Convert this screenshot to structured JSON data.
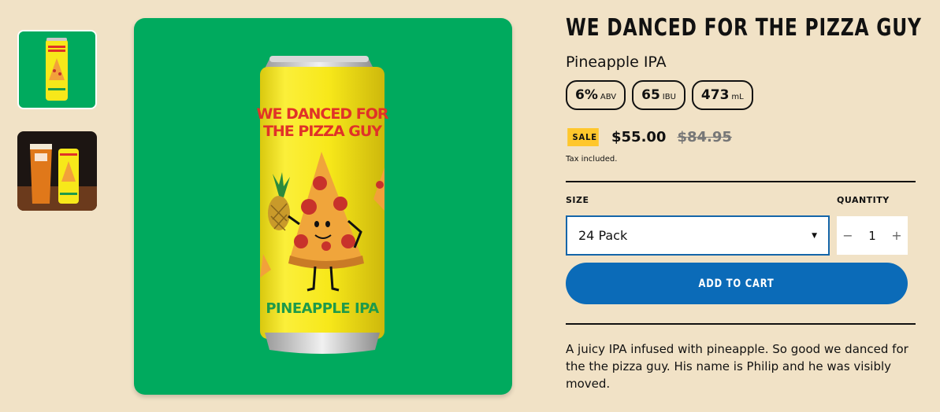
{
  "product": {
    "title": "WE DANCED FOR THE PIZZA GUY",
    "subtitle": "Pineapple IPA",
    "specs": [
      {
        "value": "6%",
        "unit": "ABV"
      },
      {
        "value": "65",
        "unit": "IBU"
      },
      {
        "value": "473",
        "unit": "mL"
      }
    ],
    "sale_label": "SALE",
    "price": "$55.00",
    "compare_price": "$84.95",
    "tax_note": "Tax included.",
    "size_label": "SIZE",
    "size_value": "24 Pack",
    "quantity_label": "QUANTITY",
    "quantity": "1",
    "qty_minus": "−",
    "qty_plus": "+",
    "add_to_cart": "ADD TO CART",
    "description": "A juicy IPA infused with pineapple. So good we danced for the the pizza guy. His name is Philip and he was visibly moved."
  },
  "can_art": {
    "line1": "WE DANCED FOR",
    "line2": "THE PIZZA GUY",
    "bottom": "PINEAPPLE IPA"
  },
  "colors": {
    "background": "#f1e2c6",
    "image_bg": "#00aa5e",
    "can_yellow": "#f7e81a",
    "brand_red": "#e03228",
    "brand_green": "#1e9a4a",
    "button_blue": "#0b6bb8",
    "sale_yellow": "#ffc72c"
  }
}
